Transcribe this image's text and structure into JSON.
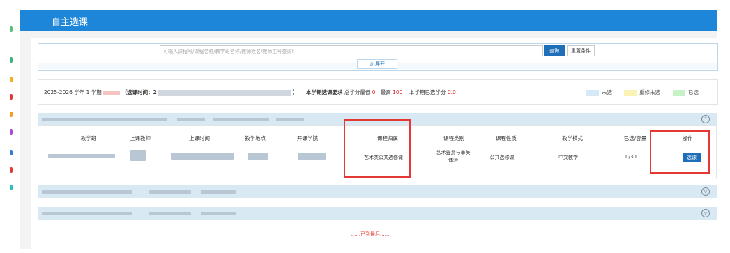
{
  "window": {
    "title": "自主选课"
  },
  "search": {
    "placeholder": "可输入课程号/课程名称/教学班名称/教师姓名/教师工号查询!",
    "query_label": "查询",
    "reset_label": "重置条件",
    "expand_label": "展开"
  },
  "term_info": {
    "term_text": "2025-2026 学年 1 学期",
    "time_label": "（选课时间：2",
    "time_close": "）",
    "requirement_label": "本学期选课要求",
    "min_text": "总学分最低",
    "min_value": "0",
    "max_text": "最高",
    "max_value": "100",
    "selected_text": "本学期已选学分",
    "selected_value": "0.0"
  },
  "legend": {
    "items": [
      {
        "label": "未选",
        "color": "#d6e9f7"
      },
      {
        "label": "重修未选",
        "color": "#fbf3b4"
      },
      {
        "label": "已选",
        "color": "#c7f1c7"
      }
    ]
  },
  "table": {
    "headers": [
      "教学班",
      "上课教师",
      "上课时间",
      "教学地点",
      "开课学院",
      "课程归属",
      "课程类别",
      "课程性质",
      "教学模式",
      "已选/容量",
      "操作"
    ],
    "row": {
      "attribution": "艺术类公共选修课",
      "category_line1": "艺术鉴赏与审美",
      "category_line2": "体验",
      "nature": "公共选修课",
      "mode": "中文教学",
      "capacity": "0/30",
      "action_label": "选课"
    }
  },
  "footer": {
    "end_text": "......已到最后......"
  },
  "colors": {
    "brand": "#1e86d9",
    "button": "#1e6fb8",
    "highlight": "#e53935"
  }
}
